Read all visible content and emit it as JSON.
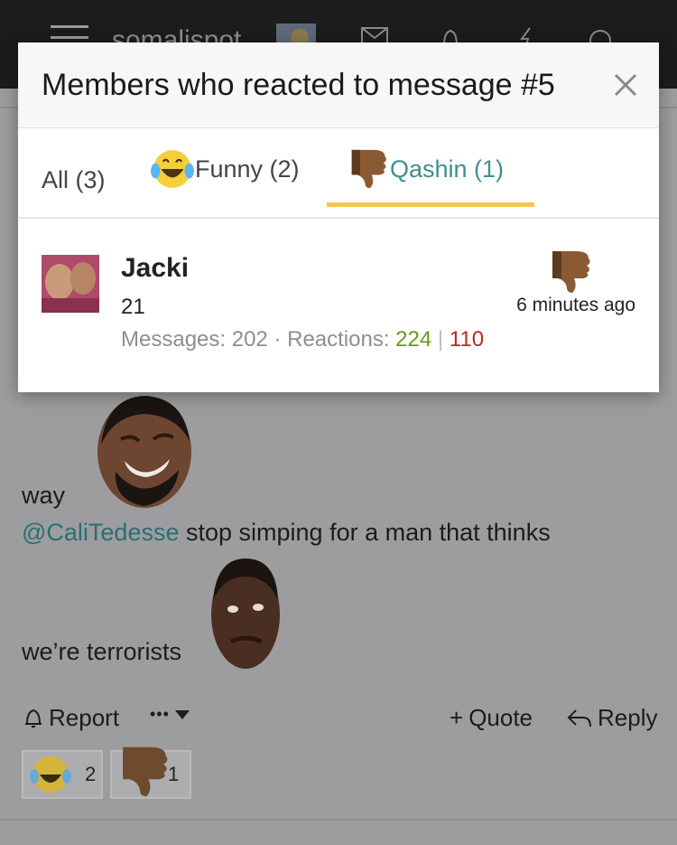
{
  "header": {
    "logo_text": "somalispot"
  },
  "modal": {
    "title": "Members who reacted to message #5",
    "tabs": [
      {
        "label": "All (3)"
      },
      {
        "label": "Funny (2)"
      },
      {
        "label": "Qashin (1)"
      }
    ],
    "active_tab": 2,
    "members": [
      {
        "name": "Jacki",
        "title": "21",
        "messages_label": "Messages: 202",
        "dot": "·",
        "reactions_label": "Reactions:",
        "reactions_positive": "224",
        "reactions_separator": "|",
        "reactions_negative": "110",
        "time": "6 minutes ago",
        "reaction_icon": "thumbs-down-icon"
      }
    ]
  },
  "post": {
    "line1": "way",
    "mention": "@CaliTedesse",
    "line2_rest": " stop simping for a man that thinks",
    "line3": "we’re terrorists"
  },
  "actions": {
    "report": "Report",
    "more": "•••",
    "quote": "Quote",
    "reply": "Reply"
  },
  "reactions_bar": [
    {
      "icon": "laughing-emoji-icon",
      "count": "2"
    },
    {
      "icon": "thumbs-down-icon",
      "count": "1"
    }
  ],
  "colors": {
    "accent_teal": "#3f8f8f",
    "tab_underline": "#f4c84a",
    "positive": "#6a9a1a",
    "negative": "#c0281c"
  }
}
